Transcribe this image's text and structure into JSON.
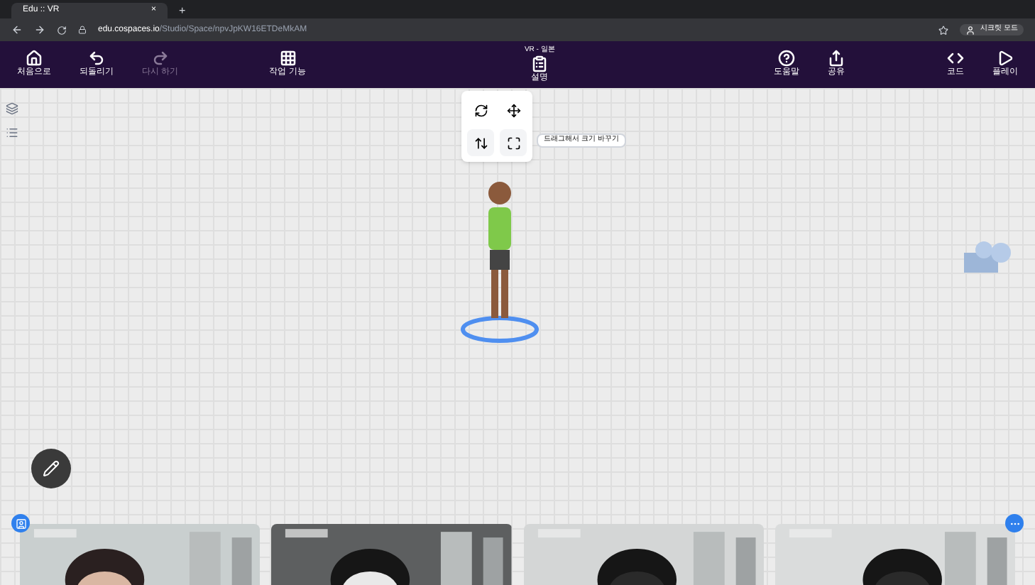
{
  "browser": {
    "tab_title": "Edu :: VR",
    "close": "×",
    "new_tab": "+",
    "url_host": "edu.cospaces.io",
    "url_path": "/Studio/Space/npvJpKW16ETDeMkAM",
    "profile": "시크릿 모드"
  },
  "toolbar": {
    "title": "VR - 일본",
    "left": [
      {
        "label": "처음으로",
        "kind": "home",
        "disabled": false
      },
      {
        "label": "되돌리기",
        "kind": "undo",
        "disabled": false
      },
      {
        "label": "다시 하기",
        "kind": "redo",
        "disabled": true
      },
      {
        "label": "작업 기능",
        "kind": "grid",
        "disabled": false
      }
    ],
    "center": {
      "label": "설명",
      "kind": "doc"
    },
    "right": [
      {
        "label": "도움말",
        "kind": "help"
      },
      {
        "label": "공유",
        "kind": "share"
      },
      {
        "label": "코드",
        "kind": "code"
      },
      {
        "label": "플레이",
        "kind": "play"
      }
    ]
  },
  "editor": {
    "tooltip": "드래그해서 크기 바꾸기"
  }
}
